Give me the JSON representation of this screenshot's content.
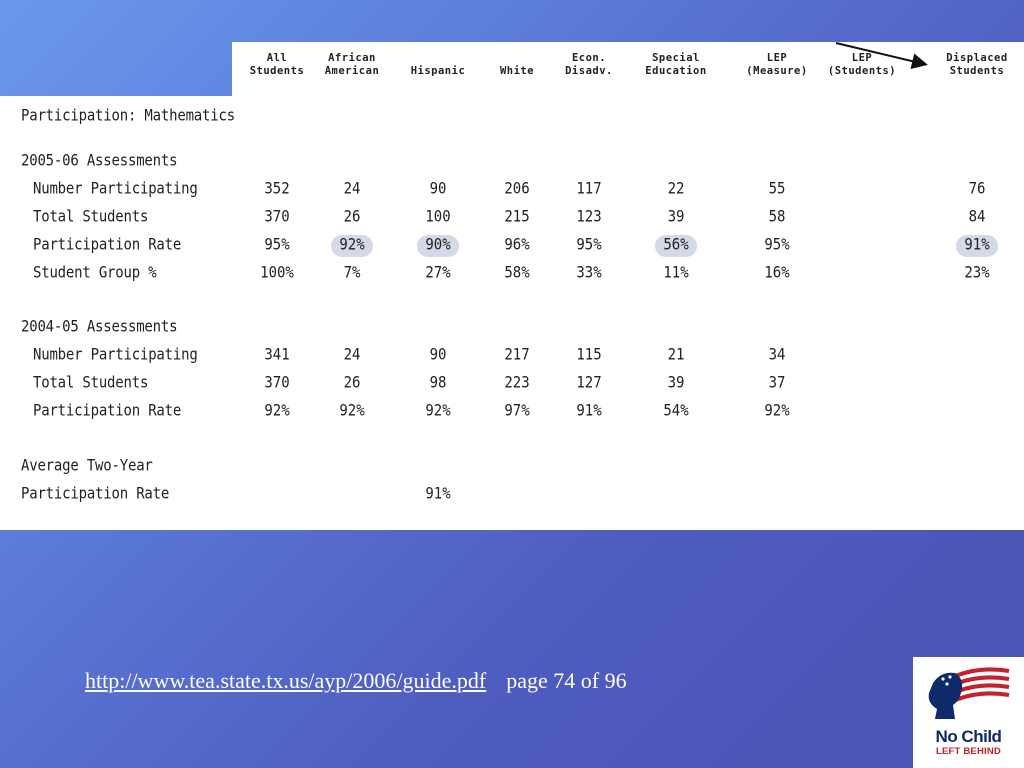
{
  "table": {
    "columns": [
      {
        "id": "all",
        "line1": "All",
        "line2": "Students"
      },
      {
        "id": "african",
        "line1": "African",
        "line2": "American"
      },
      {
        "id": "hispanic",
        "line1": "",
        "line2": "Hispanic"
      },
      {
        "id": "white",
        "line1": "",
        "line2": "White"
      },
      {
        "id": "econ",
        "line1": "Econ.",
        "line2": "Disadv."
      },
      {
        "id": "special",
        "line1": "Special",
        "line2": "Education"
      },
      {
        "id": "lep_measure",
        "line1": "LEP",
        "line2": "(Measure)"
      },
      {
        "id": "lep_students",
        "line1": "LEP",
        "line2": "(Students)"
      },
      {
        "id": "displaced",
        "line1": "Displaced",
        "line2": "Students"
      }
    ],
    "section_title": "Participation: Mathematics",
    "sections": [
      {
        "heading": "2005-06 Assessments",
        "rows": [
          {
            "label": "Number Participating",
            "values": [
              "352",
              "24",
              "90",
              "206",
              "117",
              "22",
              "55",
              "",
              "76"
            ]
          },
          {
            "label": "Total Students",
            "values": [
              "370",
              "26",
              "100",
              "215",
              "123",
              "39",
              "58",
              "",
              "84"
            ]
          },
          {
            "label": "Participation Rate",
            "values": [
              "95%",
              "92%",
              "90%",
              "96%",
              "95%",
              "56%",
              "95%",
              "",
              "91%"
            ]
          },
          {
            "label": "Student Group %",
            "values": [
              "100%",
              "7%",
              "27%",
              "58%",
              "33%",
              "11%",
              "16%",
              "",
              "23%"
            ]
          }
        ]
      },
      {
        "heading": "2004-05 Assessments",
        "rows": [
          {
            "label": "Number Participating",
            "values": [
              "341",
              "24",
              "90",
              "217",
              "115",
              "21",
              "34",
              "",
              ""
            ]
          },
          {
            "label": "Total Students",
            "values": [
              "370",
              "26",
              "98",
              "223",
              "127",
              "39",
              "37",
              "",
              ""
            ]
          },
          {
            "label": "Participation Rate",
            "values": [
              "92%",
              "92%",
              "92%",
              "97%",
              "91%",
              "54%",
              "92%",
              "",
              ""
            ]
          }
        ]
      }
    ],
    "average": {
      "label_line1": "Average Two-Year",
      "label_line2": "Participation Rate",
      "values": [
        "",
        "",
        "91%",
        "",
        "",
        "",
        "",
        "",
        ""
      ]
    }
  },
  "footer": {
    "link": "http://www.tea.state.tx.us/ayp/2006/guide.pdf",
    "page": "page 74 of 96"
  },
  "logo": {
    "line1": "No Child",
    "line2": "LEFT BEHIND"
  },
  "colors": {
    "background_top": "#6a98ec",
    "background_bottom": "#4a55b2",
    "highlight": "#d4d9e8",
    "logo_blue": "#0e2a6b",
    "logo_red": "#c8202a"
  }
}
